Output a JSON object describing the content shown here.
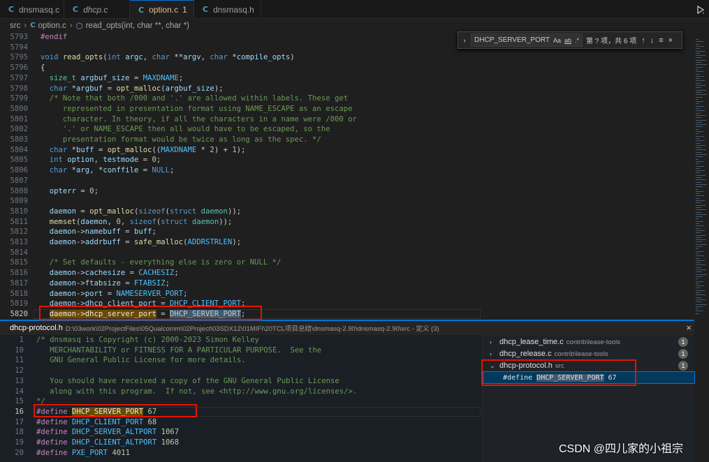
{
  "tabs": [
    {
      "icon": "C",
      "name": "dnsmasq.c",
      "italic": false,
      "modified": ""
    },
    {
      "icon": "C",
      "name": "dhcp.c",
      "italic": true,
      "modified": ""
    },
    {
      "icon": "C",
      "name": "option.c",
      "italic": false,
      "modified": "1",
      "close": "×"
    },
    {
      "icon": "C",
      "name": "dnsmasq.h",
      "italic": false,
      "modified": ""
    }
  ],
  "breadcrumb": {
    "folder": "src",
    "file_icon": "C",
    "file": "option.c",
    "symbol_icon": "⬡",
    "symbol": "read_opts(int, char **, char *)",
    "sep": "›"
  },
  "find": {
    "toggle": "›",
    "query": "DHCP_SERVER_PORT",
    "opt_case": "Aa",
    "opt_word": "ab",
    "opt_regex": ".*",
    "status": "第 ? 项，共 6 项",
    "prev": "↑",
    "next": "↓",
    "selection": "≡",
    "close": "×"
  },
  "editor": {
    "lines": [
      {
        "n": "5793",
        "segs": [
          {
            "t": "#endif",
            "c": "pp"
          }
        ]
      },
      {
        "n": "5794",
        "segs": []
      },
      {
        "n": "5795",
        "segs": [
          {
            "t": "void ",
            "c": "kw"
          },
          {
            "t": "read_opts",
            "c": "fnc"
          },
          {
            "t": "(",
            "c": ""
          },
          {
            "t": "int ",
            "c": "kw"
          },
          {
            "t": "argc",
            "c": "va"
          },
          {
            "t": ", ",
            "c": ""
          },
          {
            "t": "char ",
            "c": "kw"
          },
          {
            "t": "**",
            "c": ""
          },
          {
            "t": "argv",
            "c": "va"
          },
          {
            "t": ", ",
            "c": ""
          },
          {
            "t": "char ",
            "c": "kw"
          },
          {
            "t": "*",
            "c": ""
          },
          {
            "t": "compile_opts",
            "c": "va"
          },
          {
            "t": ")",
            "c": ""
          }
        ]
      },
      {
        "n": "5796",
        "segs": [
          {
            "t": "{",
            "c": "fnc"
          }
        ]
      },
      {
        "n": "5797",
        "segs": [
          {
            "t": "  size_t ",
            "c": "ty"
          },
          {
            "t": "argbuf_size",
            "c": "va"
          },
          {
            "t": " = ",
            "c": ""
          },
          {
            "t": "MAXDNAME",
            "c": "mc"
          },
          {
            "t": ";",
            "c": ""
          }
        ]
      },
      {
        "n": "5798",
        "segs": [
          {
            "t": "  char ",
            "c": "kw"
          },
          {
            "t": "*",
            "c": ""
          },
          {
            "t": "argbuf",
            "c": "va"
          },
          {
            "t": " = ",
            "c": ""
          },
          {
            "t": "opt_malloc",
            "c": "fnc"
          },
          {
            "t": "(",
            "c": ""
          },
          {
            "t": "argbuf_size",
            "c": "va"
          },
          {
            "t": ");",
            "c": ""
          }
        ]
      },
      {
        "n": "5799",
        "segs": [
          {
            "t": "  /* Note that both /000 and '.' are allowed within labels. These get",
            "c": "cm"
          }
        ]
      },
      {
        "n": "5800",
        "segs": [
          {
            "t": "     represented in presentation format using NAME_ESCAPE as an escape",
            "c": "cm"
          }
        ]
      },
      {
        "n": "5801",
        "segs": [
          {
            "t": "     character. In theory, if all the characters in a name were /000 or",
            "c": "cm"
          }
        ]
      },
      {
        "n": "5802",
        "segs": [
          {
            "t": "     '.' or NAME_ESCAPE then all would have to be escaped, so the",
            "c": "cm"
          }
        ]
      },
      {
        "n": "5803",
        "segs": [
          {
            "t": "     presentation format would be twice as long as the spec. */",
            "c": "cm"
          }
        ]
      },
      {
        "n": "5804",
        "segs": [
          {
            "t": "  char ",
            "c": "kw"
          },
          {
            "t": "*",
            "c": ""
          },
          {
            "t": "buff",
            "c": "va"
          },
          {
            "t": " = ",
            "c": ""
          },
          {
            "t": "opt_malloc",
            "c": "fnc"
          },
          {
            "t": "((",
            "c": ""
          },
          {
            "t": "MAXDNAME",
            "c": "mc"
          },
          {
            "t": " * ",
            "c": ""
          },
          {
            "t": "2",
            "c": "nu"
          },
          {
            "t": ") + ",
            "c": ""
          },
          {
            "t": "1",
            "c": "nu"
          },
          {
            "t": ");",
            "c": ""
          }
        ]
      },
      {
        "n": "5805",
        "segs": [
          {
            "t": "  int ",
            "c": "kw"
          },
          {
            "t": "option",
            "c": "va"
          },
          {
            "t": ", ",
            "c": ""
          },
          {
            "t": "testmode",
            "c": "va"
          },
          {
            "t": " = ",
            "c": ""
          },
          {
            "t": "0",
            "c": "nu"
          },
          {
            "t": ";",
            "c": ""
          }
        ]
      },
      {
        "n": "5806",
        "segs": [
          {
            "t": "  char ",
            "c": "kw"
          },
          {
            "t": "*",
            "c": ""
          },
          {
            "t": "arg",
            "c": "va"
          },
          {
            "t": ", *",
            "c": ""
          },
          {
            "t": "conffile",
            "c": "va"
          },
          {
            "t": " = ",
            "c": ""
          },
          {
            "t": "NULL",
            "c": "kw"
          },
          {
            "t": ";",
            "c": ""
          }
        ]
      },
      {
        "n": "5807",
        "segs": []
      },
      {
        "n": "5808",
        "segs": [
          {
            "t": "  opterr",
            "c": "va"
          },
          {
            "t": " = ",
            "c": ""
          },
          {
            "t": "0",
            "c": "nu"
          },
          {
            "t": ";",
            "c": ""
          }
        ]
      },
      {
        "n": "5809",
        "segs": []
      },
      {
        "n": "5810",
        "segs": [
          {
            "t": "  daemon",
            "c": "va"
          },
          {
            "t": " = ",
            "c": ""
          },
          {
            "t": "opt_malloc",
            "c": "fnc"
          },
          {
            "t": "(",
            "c": ""
          },
          {
            "t": "sizeof",
            "c": "kw"
          },
          {
            "t": "(",
            "c": ""
          },
          {
            "t": "struct ",
            "c": "kw"
          },
          {
            "t": "daemon",
            "c": "ty"
          },
          {
            "t": "));",
            "c": ""
          }
        ]
      },
      {
        "n": "5811",
        "segs": [
          {
            "t": "  memset",
            "c": "fnc"
          },
          {
            "t": "(",
            "c": ""
          },
          {
            "t": "daemon",
            "c": "va"
          },
          {
            "t": ", ",
            "c": ""
          },
          {
            "t": "0",
            "c": "nu"
          },
          {
            "t": ", ",
            "c": ""
          },
          {
            "t": "sizeof",
            "c": "kw"
          },
          {
            "t": "(",
            "c": ""
          },
          {
            "t": "struct ",
            "c": "kw"
          },
          {
            "t": "daemon",
            "c": "ty"
          },
          {
            "t": "));",
            "c": ""
          }
        ]
      },
      {
        "n": "5812",
        "segs": [
          {
            "t": "  daemon",
            "c": "va"
          },
          {
            "t": "->",
            "c": ""
          },
          {
            "t": "namebuff",
            "c": "va"
          },
          {
            "t": " = ",
            "c": ""
          },
          {
            "t": "buff",
            "c": "va"
          },
          {
            "t": ";",
            "c": ""
          }
        ]
      },
      {
        "n": "5813",
        "segs": [
          {
            "t": "  daemon",
            "c": "va"
          },
          {
            "t": "->",
            "c": ""
          },
          {
            "t": "addrbuff",
            "c": "va"
          },
          {
            "t": " = ",
            "c": ""
          },
          {
            "t": "safe_malloc",
            "c": "fnc"
          },
          {
            "t": "(",
            "c": ""
          },
          {
            "t": "ADDRSTRLEN",
            "c": "mc"
          },
          {
            "t": ");",
            "c": ""
          }
        ]
      },
      {
        "n": "5814",
        "segs": []
      },
      {
        "n": "5815",
        "segs": [
          {
            "t": "  /* Set defaults - everything else is zero or NULL */",
            "c": "cm"
          }
        ]
      },
      {
        "n": "5816",
        "segs": [
          {
            "t": "  daemon",
            "c": "va"
          },
          {
            "t": "->",
            "c": ""
          },
          {
            "t": "cachesize",
            "c": "va"
          },
          {
            "t": " = ",
            "c": ""
          },
          {
            "t": "CACHESIZ",
            "c": "mc"
          },
          {
            "t": ";",
            "c": ""
          }
        ]
      },
      {
        "n": "5817",
        "segs": [
          {
            "t": "  daemon",
            "c": "va"
          },
          {
            "t": "->",
            "c": ""
          },
          {
            "t": "ftabsize",
            "c": "va"
          },
          {
            "t": " = ",
            "c": ""
          },
          {
            "t": "FTABSIZ",
            "c": "mc"
          },
          {
            "t": ";",
            "c": ""
          }
        ]
      },
      {
        "n": "5818",
        "segs": [
          {
            "t": "  daemon",
            "c": "va"
          },
          {
            "t": "->",
            "c": ""
          },
          {
            "t": "port",
            "c": "va"
          },
          {
            "t": " = ",
            "c": ""
          },
          {
            "t": "NAMESERVER_PORT",
            "c": "mc"
          },
          {
            "t": ";",
            "c": ""
          }
        ]
      },
      {
        "n": "5819",
        "segs": [
          {
            "t": "  daemon",
            "c": "va"
          },
          {
            "t": "->",
            "c": ""
          },
          {
            "t": "dhcp_client_port",
            "c": "va"
          },
          {
            "t": " = ",
            "c": ""
          },
          {
            "t": "DHCP_CLIENT_PORT",
            "c": "mc"
          },
          {
            "t": ";",
            "c": ""
          }
        ]
      },
      {
        "n": "5820",
        "segs": [
          {
            "t": "  ",
            "c": ""
          },
          {
            "t": "daemon->dhcp_server_port",
            "c": "hl"
          },
          {
            "t": " = ",
            "c": ""
          },
          {
            "t": "DHCP_SERVER_PORT",
            "c": "hl2"
          },
          {
            "t": ";",
            "c": ""
          }
        ],
        "current": true
      }
    ]
  },
  "peek": {
    "file": "dhcp-protocol.h",
    "path": "D:\\03work\\02ProjectFiles\\05Qualcomm\\02Project\\03SDX12\\01MIFI\\20TCL项目总结\\dnsmasq-2.90\\dnsmasq-2.90\\src - 定义 (3)",
    "close": "×",
    "lines": [
      {
        "n": "1",
        "segs": [
          {
            "t": "/* dnsmasq is Copyright (c) 2000-2023 Simon Kelley",
            "c": "cm"
          }
        ]
      },
      {
        "n": "10",
        "segs": [
          {
            "t": "   MERCHANTABILITY or FITNESS FOR A PARTICULAR PURPOSE.  See the",
            "c": "cm"
          }
        ]
      },
      {
        "n": "11",
        "segs": [
          {
            "t": "   GNU General Public License for more details.",
            "c": "cm"
          }
        ]
      },
      {
        "n": "12",
        "segs": []
      },
      {
        "n": "13",
        "segs": [
          {
            "t": "   You should have received a copy of the GNU General Public License",
            "c": "cm"
          }
        ]
      },
      {
        "n": "14",
        "segs": [
          {
            "t": "   along with this program.  If not, see <http://www.gnu.org/licenses/>.",
            "c": "cm"
          }
        ]
      },
      {
        "n": "15",
        "segs": [
          {
            "t": "*/",
            "c": "cm"
          }
        ]
      },
      {
        "n": "16",
        "segs": [
          {
            "t": "#define ",
            "c": "pp"
          },
          {
            "t": "DHCP_SERVER_PORT",
            "c": "hl"
          },
          {
            "t": " ",
            "c": ""
          },
          {
            "t": "67",
            "c": "nu"
          }
        ],
        "current": true
      },
      {
        "n": "17",
        "segs": [
          {
            "t": "#define ",
            "c": "pp"
          },
          {
            "t": "DHCP_CLIENT_PORT",
            "c": "mc"
          },
          {
            "t": " ",
            "c": ""
          },
          {
            "t": "68",
            "c": "nu"
          }
        ]
      },
      {
        "n": "18",
        "segs": [
          {
            "t": "#define ",
            "c": "pp"
          },
          {
            "t": "DHCP_SERVER_ALTPORT",
            "c": "mc"
          },
          {
            "t": " ",
            "c": ""
          },
          {
            "t": "1067",
            "c": "nu"
          }
        ]
      },
      {
        "n": "19",
        "segs": [
          {
            "t": "#define ",
            "c": "pp"
          },
          {
            "t": "DHCP_CLIENT_ALTPORT",
            "c": "mc"
          },
          {
            "t": " ",
            "c": ""
          },
          {
            "t": "1068",
            "c": "nu"
          }
        ]
      },
      {
        "n": "20",
        "segs": [
          {
            "t": "#define ",
            "c": "pp"
          },
          {
            "t": "PXE_PORT",
            "c": "mc"
          },
          {
            "t": " ",
            "c": ""
          },
          {
            "t": "4011",
            "c": "nu"
          }
        ]
      }
    ],
    "results": [
      {
        "chev": "›",
        "name": "dhcp_lease_time.c",
        "path": "contrib\\lease-tools",
        "count": "1"
      },
      {
        "chev": "›",
        "name": "dhcp_release.c",
        "path": "contrib\\lease-tools",
        "count": "1"
      },
      {
        "chev": "⌄",
        "name": "dhcp-protocol.h",
        "path": "src",
        "count": "1"
      }
    ],
    "result_def": {
      "prefix": "#define ",
      "match": "DHCP_SERVER_PORT",
      "suffix": " 67"
    }
  },
  "watermark": "CSDN @四儿家的小祖宗"
}
